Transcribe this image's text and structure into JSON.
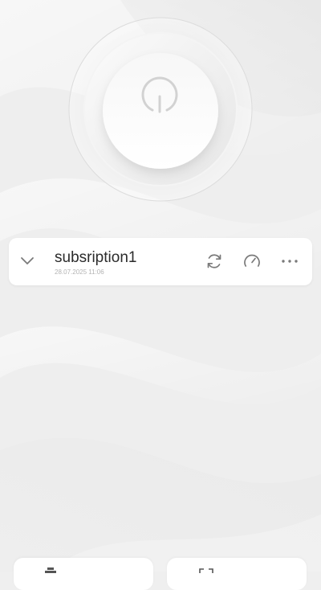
{
  "subscription": {
    "name": "subsription1",
    "updated": "28.07.2025 11:06"
  },
  "icons": {
    "power": "power-icon",
    "expand": "chevron-down-icon",
    "refresh": "refresh-icon",
    "speed": "speedometer-icon",
    "more": "more-horizontal-icon"
  },
  "colors": {
    "background": "#efefef",
    "card": "#ffffff",
    "icon": "#7a7a7a",
    "power_glyph": "#d2d2d2"
  }
}
